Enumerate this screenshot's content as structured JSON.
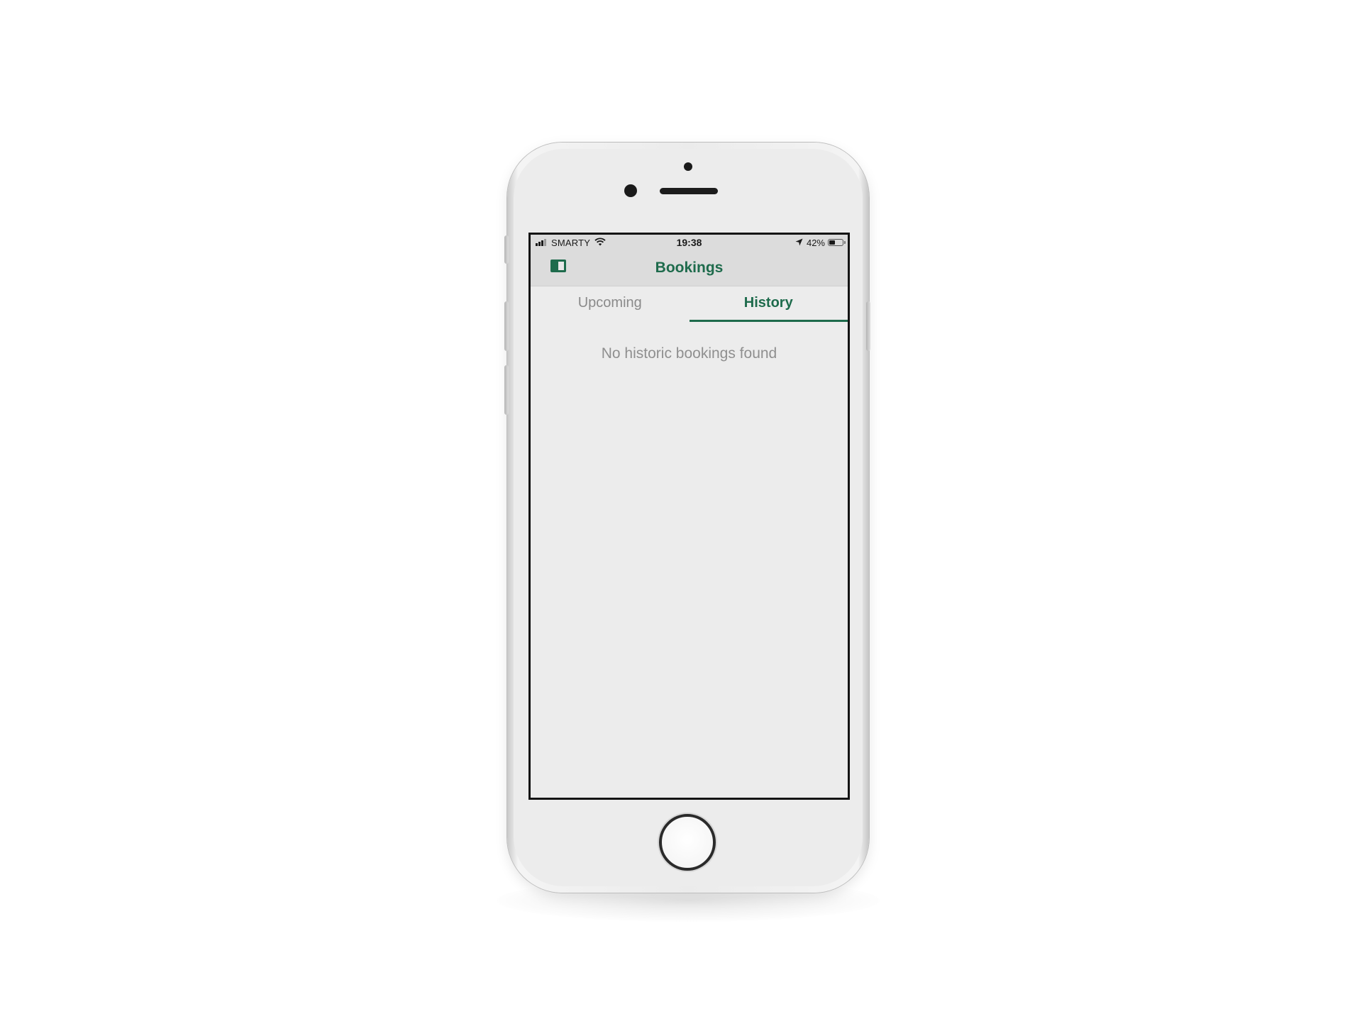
{
  "status_bar": {
    "carrier": "SMARTY",
    "time": "19:38",
    "battery_percent": "42%",
    "battery_level": 0.42,
    "icons": [
      "signal-icon",
      "wifi-icon",
      "location-arrow-icon",
      "battery-icon"
    ]
  },
  "nav": {
    "title": "Bookings",
    "menu_icon": "sidebar-toggle-icon"
  },
  "tabs": [
    {
      "label": "Upcoming",
      "active": false
    },
    {
      "label": "History",
      "active": true
    }
  ],
  "content": {
    "empty_message": "No historic bookings found"
  },
  "colors": {
    "accent": "#1e6b4c",
    "inactive_text": "#8a8a8a",
    "header_bg": "#dcdcdc",
    "content_bg": "#ececec"
  }
}
